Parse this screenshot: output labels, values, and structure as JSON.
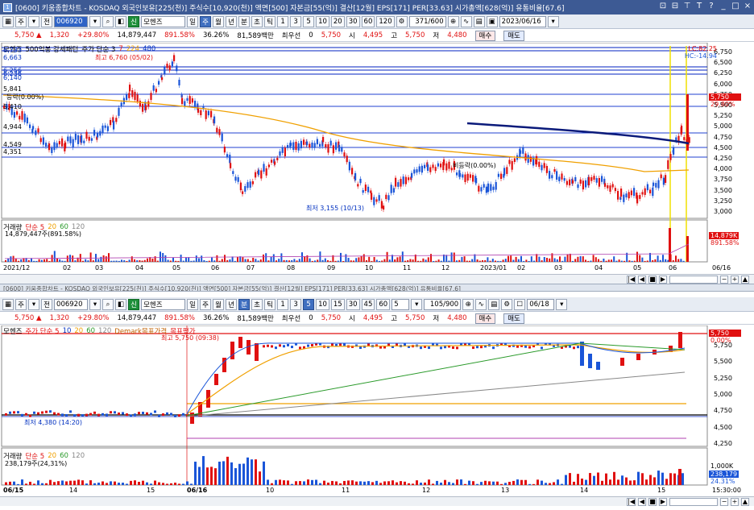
{
  "window": {
    "title": "[0600] 키움종합차트 - KOSDAQ 외국인보유[225(천)] 주식수[10,920(천)] 액면[500] 자본금[55(억)] 결산[12월] EPS[171] PER[33.63] 시가총액[628(억)] 유통비율[67.6]",
    "icon_label": "1",
    "controls": [
      "□",
      "⊟",
      "≡",
      "T",
      "?",
      "│",
      "_",
      "□",
      "×"
    ]
  },
  "top_toolbar": {
    "mode": "주",
    "dropdown": "전",
    "code": "006920",
    "sub": "K",
    "search_icon": "magnifier",
    "name_badge": "신",
    "name": "모헨즈",
    "periods": [
      "일",
      "주",
      "월",
      "년",
      "분",
      "초",
      "틱"
    ],
    "intervals": [
      "1",
      "3",
      "5",
      "10",
      "20",
      "30",
      "60",
      "120"
    ],
    "count": "371/600",
    "date": "2023/06/16"
  },
  "top_quote": {
    "price": "5,750",
    "arrow": "▲",
    "change": "1,320",
    "rate": "+29.80%",
    "volume": "14,879,447",
    "vol_rate": "891.58%",
    "turnover": "36.26%",
    "value": "81,589백만",
    "best": "최우선",
    "zero": "0",
    "open_val": "5,750",
    "open_lbl": "시",
    "open": "4,495",
    "high_lbl": "고",
    "high": "5,750",
    "low_lbl": "저",
    "low": "4,480",
    "buy": "매수",
    "sell": "매도"
  },
  "top_chart": {
    "legend": [
      "모헨즈",
      "500억봉 강세패턴",
      "주가 단순 3",
      "7",
      "224",
      "480"
    ],
    "hi_label": "최고 6,760 (05/02)",
    "lo_label": "최저 3,155 (10/13)",
    "mid_label": "등락(0.00%)",
    "mid_label2": "비등락(0.00%)",
    "left_prices": [
      "6,733",
      "6,663",
      "6,256",
      "6,236",
      "6,140",
      "5,841",
      "5,410",
      "4,944",
      "4,549",
      "4,351"
    ],
    "yaxis": [
      "6,750",
      "6,500",
      "6,250",
      "6,000",
      "5,750",
      "5,500",
      "5,250",
      "5,000",
      "4,750",
      "4,500",
      "4,250",
      "4,000",
      "3,750",
      "3,500",
      "3,250",
      "3,000"
    ],
    "tags": [
      "LC:82.25",
      "HC:-14.94",
      "5,750",
      "29.80%"
    ],
    "volume_legend": [
      "거래량",
      "단순 5",
      "20",
      "60",
      "120"
    ],
    "volume_value": "14,879,447주(891.58%)",
    "volume_tags": [
      "14,879K",
      "891.58%"
    ],
    "date_axis": [
      "2021/12",
      "02",
      "03",
      "04",
      "05",
      "06",
      "07",
      "08",
      "09",
      "10",
      "11",
      "12",
      "2023/01",
      "02",
      "03",
      "04",
      "05",
      "06",
      "06/16"
    ]
  },
  "divider_text": "[0600] 키움종합차트 - KOSDAQ 외국인보유[225(천)] 주식수[10,920(천)] 액면[500] 자본금[55(억)] 결산[12월] EPS[171] PER[33.63] 시가총액[628(억)] 유통비율[67.6]",
  "bottom_toolbar": {
    "mode": "주",
    "dropdown": "전",
    "code": "006920",
    "name_badge": "신",
    "name": "모헨즈",
    "periods": [
      "일",
      "주",
      "월",
      "년",
      "분",
      "초",
      "틱"
    ],
    "intervals": [
      "1",
      "3",
      "5",
      "10",
      "15",
      "30",
      "45",
      "60"
    ],
    "interval_value": "5",
    "count": "105/900",
    "date": "06/18"
  },
  "bottom_quote": {
    "price": "5,750",
    "arrow": "▲",
    "change": "1,320",
    "rate": "+29.80%",
    "volume": "14,879,447",
    "vol_rate": "891.58%",
    "turnover": "36.26%",
    "value": "81,589백만",
    "best": "최우선",
    "zero": "0",
    "open_val": "5,750",
    "open_lbl": "시",
    "open": "4,495",
    "high_lbl": "고",
    "high": "5,750",
    "low_lbl": "저",
    "low": "4,480",
    "buy": "매수",
    "sell": "매도"
  },
  "bottom_chart": {
    "legend": [
      "모헨즈",
      "주가 단순 5",
      "10",
      "20",
      "60",
      "120",
      "Demark목표가격",
      "목표평가"
    ],
    "hi_label": "최고 5,750 (09:38)",
    "lo_label": "최저 4,380 (14:20)",
    "yaxis": [
      "5,750",
      "5,500",
      "5,250",
      "5,000",
      "4,750",
      "4,500",
      "4,250"
    ],
    "tags": [
      "5,750",
      "0.00%"
    ],
    "volume_legend": [
      "거래량",
      "단순 5",
      "20",
      "60",
      "120"
    ],
    "volume_value": "238,179주(24,31%)",
    "volume_tags": [
      "1,000K",
      "238,179",
      "24.31%"
    ],
    "date_axis": [
      "06/15",
      "14",
      "15",
      "06/16",
      "10",
      "11",
      "12",
      "13",
      "14",
      "15",
      "15:30:00"
    ]
  },
  "colors": {
    "up": "#e01010",
    "down": "#1a55d8",
    "ma_orange": "#f0a000",
    "ma_navy": "#0a1a7a",
    "ma_green": "#2a9a2a",
    "ma_purple": "#b040b0",
    "yellow": "#f0e000"
  }
}
